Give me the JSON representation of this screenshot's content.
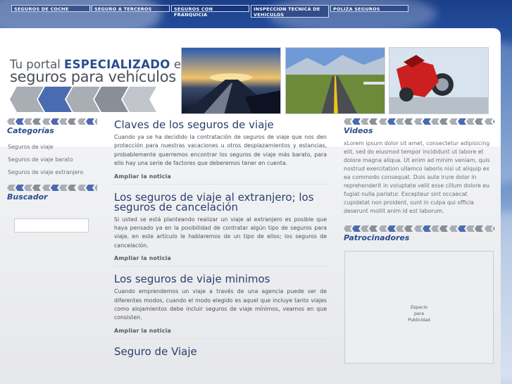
{
  "nav": {
    "items": [
      "SEGUROS DE COCHE",
      "SEGURO A TERCEROS",
      "SEGUROS CON FRANQUICIA",
      "INSPECCION TECNICA DE VEHICULOS",
      "POLIZA SEGUROS"
    ]
  },
  "header": {
    "tagline_pre": "Tu portal ",
    "tagline_bold": "ESPECIALIZADO",
    "tagline_post": " en",
    "tagline_line2": "seguros para vehículos"
  },
  "sidebar": {
    "categories_title": "Categorías",
    "categories": [
      "Seguros de viaje",
      "Seguros de viaje barato",
      "Seguros de viaje extranjero"
    ],
    "search_title": "Buscador",
    "search_placeholder": ""
  },
  "posts": [
    {
      "title": "Claves de los seguros de viaje",
      "body": "Cuando ya se ha decidido la contratación de seguros de viaje que nos den protección para nuestras vacaciones u otros desplazamientos y estancias, probablemente querremos encontrar los seguros de viaje más barato, para ello hay una serie de factores que deberemos tener en cuenta.",
      "more": "Ampliar la noticia"
    },
    {
      "title": "Los seguros de viaje al extranjero; los seguros de cancelación",
      "body": "Si usted se está planteando realizar un viaje al extranjero es posible que haya pensado ya en la posibilidad de contratar algún tipo de seguros para viaje, en este articulo le hablaremos de un tipo de ellos; los seguros de cancelación.",
      "more": "Ampliar la noticia"
    },
    {
      "title": "Los seguros de viaje minimos",
      "body": "Cuando emprendemos un viaje a través de una agencia puede ser de diferentes modos, cuando el modo elegido es aquel que incluye tanto viajes como alojamientos debe incluir seguros de viaje mínimos, veamos en que consisten.",
      "more": "Ampliar la noticia"
    },
    {
      "title": "Seguro de Viaje",
      "body": "",
      "more": ""
    }
  ],
  "right": {
    "videos_title": "Videos",
    "videos_text": "xLorem ipsum dolor sit amet, consectetur adipisicing elit, sed do eiusmod tempor incididunt ut labore et dolore magna aliqua. Ut enim ad minim veniam, quis nostrud exercitation ullamco laboris nisi ut aliquip ex ea commodo consequat. Duis aute irure dolor in reprehenderit in voluptate velit esse cillum dolore eu fugiat nulla pariatur. Excepteur sint occaecat cupidatat non proident, sunt in culpa qui officia deserunt mollit anim id est laborum.",
    "sponsors_title": "Patrocinadores",
    "ad_line1": "Espacio",
    "ad_line2": "para",
    "ad_line3": "Publicidad"
  },
  "colors": {
    "accent": "#2a4d8f",
    "chevron_blue": "#4a6bb0",
    "chevron_grey": "#a9adb4"
  }
}
